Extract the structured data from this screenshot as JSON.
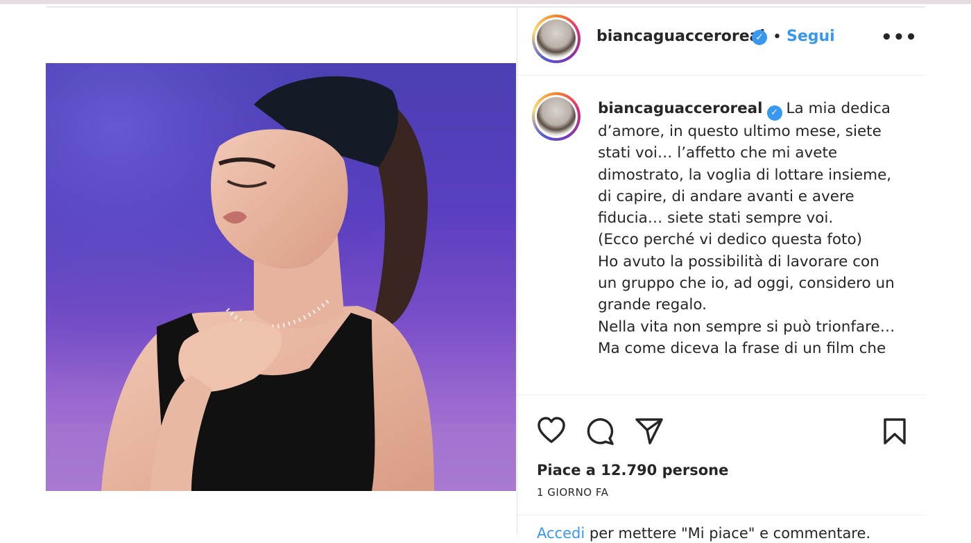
{
  "post": {
    "username": "biancaguacceroreal",
    "verified": true,
    "separator": "•",
    "follow_label": "Segui",
    "more_label": "•••",
    "caption": "La mia dedica d’amore, in questo ultimo mese, siete stati voi… l’affetto che mi avete dimostrato, la voglia di lottare insieme, di capire, di andare avanti e avere fiducia… siete stati sempre voi.\n(Ecco perché vi dedico questa foto)\nHo avuto la possibilità di lavorare con un gruppo che io, ad oggi, considero un grande regalo.\nNella vita non sempre si può trionfare…\nMa come diceva la frase di un film che",
    "likes_text": "Piace a 12.790 persone",
    "timestamp": "1 GIORNO FA",
    "login_link": "Accedi",
    "login_rest": " per mettere \"Mi piace\" e commentare."
  },
  "icons": {
    "verified": "verified-badge-icon",
    "like": "heart-icon",
    "comment": "comment-bubble-icon",
    "share": "paper-plane-icon",
    "save": "bookmark-icon"
  },
  "colors": {
    "link_blue": "#3897f0",
    "text": "#262626",
    "divider": "#efefef"
  }
}
